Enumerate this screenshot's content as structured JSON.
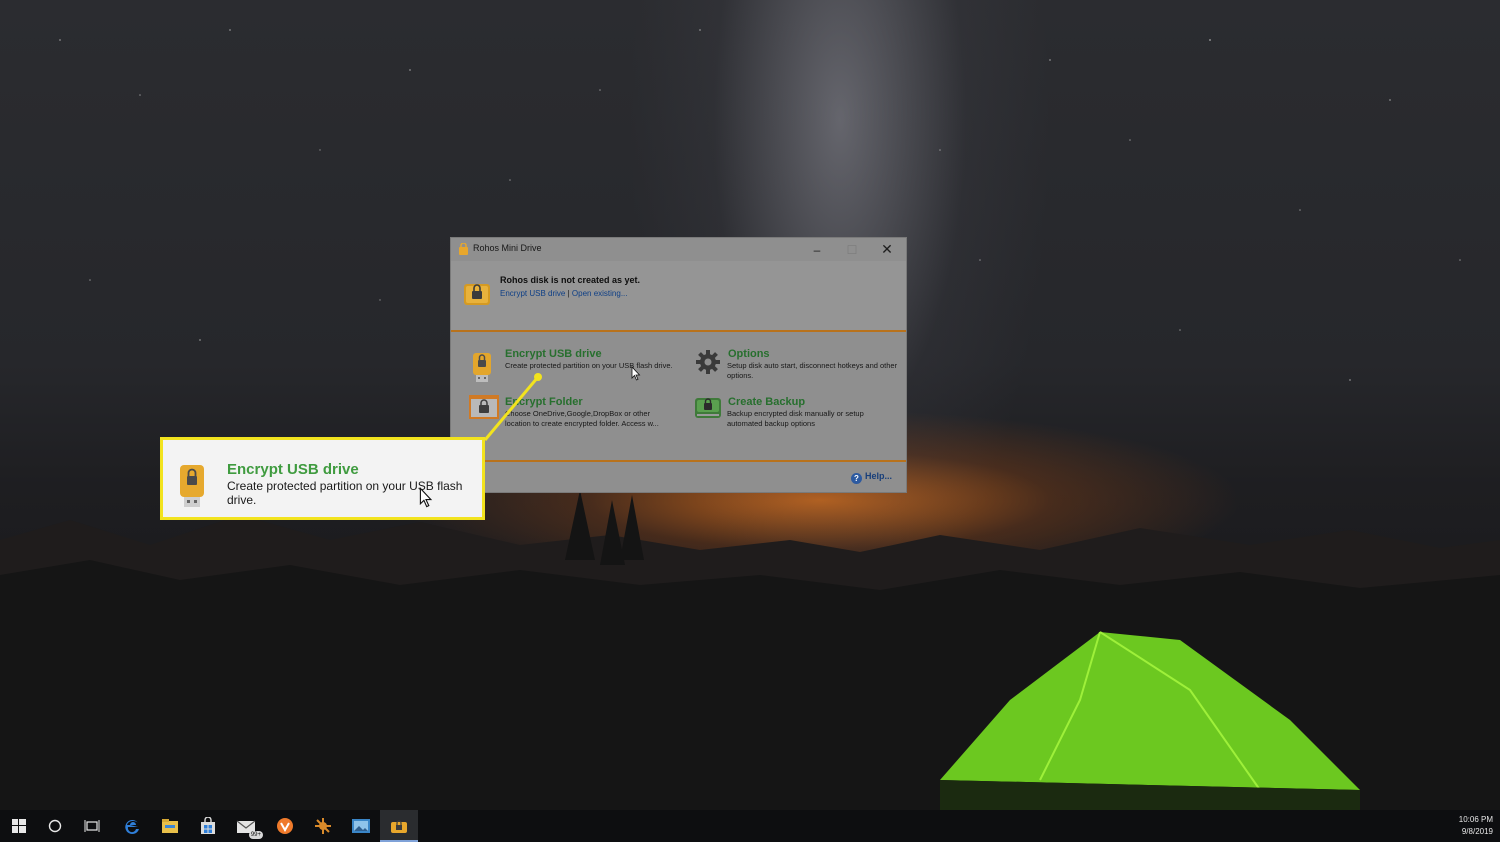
{
  "window": {
    "title": "Rohos Mini Drive",
    "controls": {
      "minimize": "–",
      "maximize": "☐",
      "close": "✕"
    }
  },
  "header": {
    "status": "Rohos disk is not created as yet.",
    "link_encrypt": "Encrypt USB drive",
    "separator": "|",
    "link_open": "Open existing..."
  },
  "items": {
    "encrypt_usb": {
      "title": "Encrypt USB drive",
      "desc": "Create protected partition on your USB flash drive.",
      "icon": "usb-lock-icon"
    },
    "options": {
      "title": "Options",
      "desc": "Setup disk auto start, disconnect hotkeys and other options.",
      "icon": "gear-icon"
    },
    "encrypt_folder": {
      "title": "Encrypt Folder",
      "desc": "Choose OneDrive,Google,DropBox or other location to create encrypted folder. Access w...",
      "icon": "folder-lock-icon"
    },
    "create_backup": {
      "title": "Create Backup",
      "desc": "Backup encrypted disk manually or setup automated backup options",
      "icon": "backup-disk-icon"
    }
  },
  "footer": {
    "help": "Help..."
  },
  "callout": {
    "title": "Encrypt USB drive",
    "desc": "Create protected partition on your USB flash drive.",
    "border_color": "#f2e31e"
  },
  "taskbar": {
    "items": [
      "windows-start-icon",
      "search-circle-icon",
      "task-view-icon",
      "edge-icon",
      "file-explorer-icon",
      "store-icon",
      "mail-icon",
      "vivaldi-icon",
      "app-icon",
      "photos-icon",
      "rohos-icon"
    ],
    "mail_badge": "99+",
    "time": "10:06 PM",
    "date": "9/8/2019"
  },
  "colors": {
    "accent_orange": "#b8721c",
    "title_green": "#276f2e",
    "callout_green": "#3f9b3f"
  }
}
